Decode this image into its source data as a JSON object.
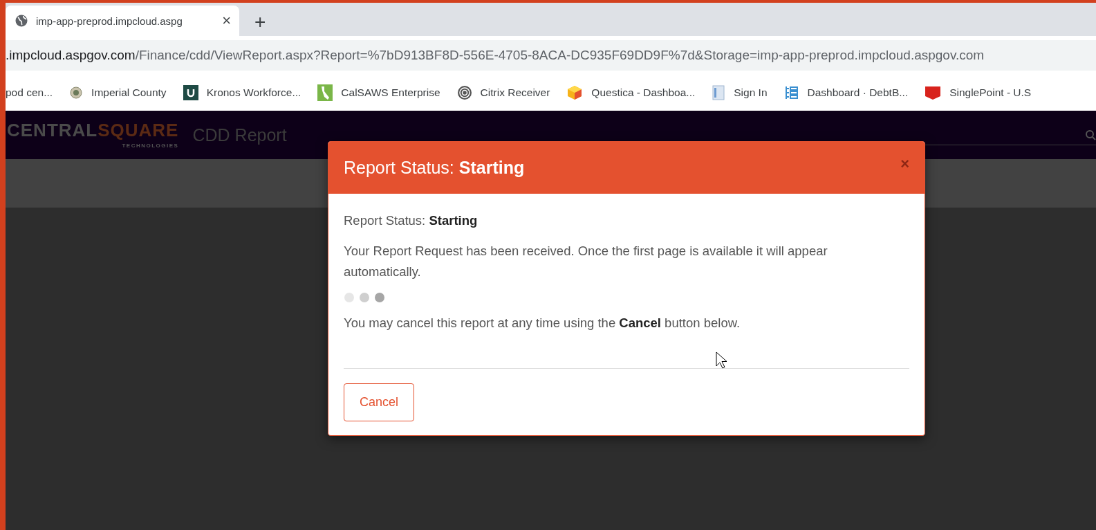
{
  "browser": {
    "tab": {
      "title": "imp-app-preprod.impcloud.aspg",
      "close": "×"
    },
    "new_tab": "+",
    "url": {
      "host": ".impcloud.aspgov.com",
      "rest": "/Finance/cdd/ViewReport.aspx?Report=%7bD913BF8D-556E-4705-8ACA-DC935F69DD9F%7d&Storage=imp-app-preprod.impcloud.aspgov.com"
    },
    "bookmarks": [
      {
        "label": "pod cen...",
        "kind": "none"
      },
      {
        "label": "Imperial County",
        "kind": "seal"
      },
      {
        "label": "Kronos Workforce...",
        "kind": "kronos"
      },
      {
        "label": "CalSAWS Enterprise",
        "kind": "calsaws"
      },
      {
        "label": "Citrix Receiver",
        "kind": "citrix"
      },
      {
        "label": "Questica - Dashboa...",
        "kind": "questica"
      },
      {
        "label": "Sign In",
        "kind": "document"
      },
      {
        "label": "Dashboard · DebtB...",
        "kind": "dashboard"
      },
      {
        "label": "SinglePoint - U.S",
        "kind": "singlepoint"
      }
    ]
  },
  "app": {
    "logo": {
      "word_1": "CENTRAL",
      "word_2": "SQUARE",
      "tagline": "TECHNOLOGIES"
    },
    "title": "CDD Report"
  },
  "dialog": {
    "title": "Report Status: **Starting**",
    "status_line": "Report Status: **Starting**",
    "message": "Your Report Request has been received. Once the first page is available it will appear automatically.",
    "cancel_note": "You may cancel this report at any time using the **Cancel** button below.",
    "close": "×",
    "buttons": [
      "Cancel"
    ]
  }
}
